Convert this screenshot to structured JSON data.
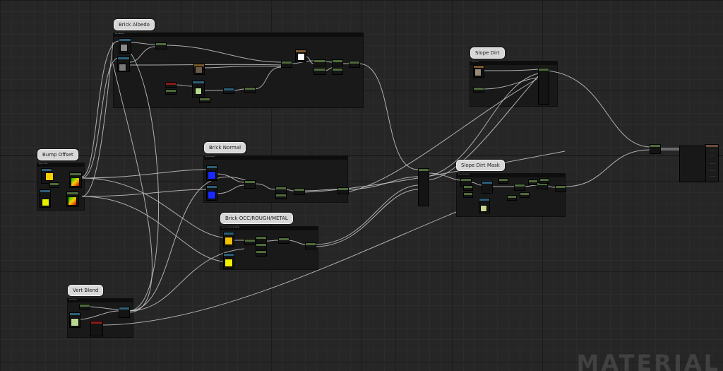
{
  "comments": [
    {
      "id": "brick-albedo",
      "label": "Brick Albedo",
      "tag": "Brick Albedo"
    },
    {
      "id": "slope-dirt",
      "label": "Slope Dirt",
      "tag": "Slope Dirt"
    },
    {
      "id": "bump-offset",
      "label": "Bump Offset",
      "tag": "Bump Offset"
    },
    {
      "id": "brick-normal",
      "label": "Brick Normal",
      "tag": "Brick Normal"
    },
    {
      "id": "slope-dirt-mask",
      "label": "Slope Dirt Mask",
      "tag": "Slope Dirt Mask"
    },
    {
      "id": "brick-orm",
      "label": "Brick OCC/ROUGH/METAL",
      "tag": "Brick OCC/ROUGH/METAL"
    },
    {
      "id": "vert-blend",
      "label": "Vert Blend",
      "tag": "Vert Blend"
    }
  ],
  "watermark": "MATERIAL",
  "colors": {
    "background": "#262626",
    "comment_box": "#191919",
    "comment_bubble": "#d8d8d8",
    "node_header_green": "#4e6a3a",
    "node_header_blue": "#2d5f78",
    "node_header_red": "#8a1c1c",
    "node_header_brown": "#7a5a2a",
    "swatch_yellow": "#f5d000",
    "swatch_blue": "#1a2aff",
    "swatch_gray": "#8a8a8a",
    "swatch_white": "#ffffff",
    "wire": "#c8c8c8"
  }
}
